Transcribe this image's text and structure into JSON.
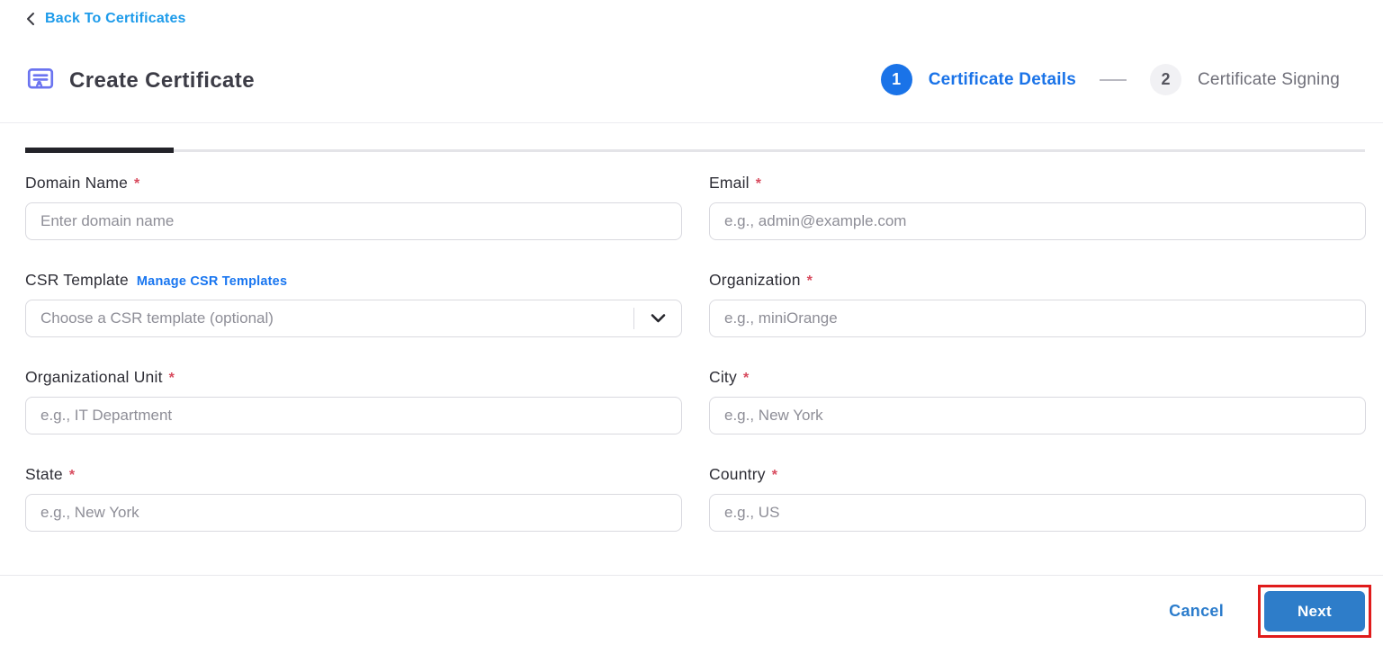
{
  "page": {
    "back_link": "Back To Certificates",
    "title": "Create Certificate"
  },
  "stepper": {
    "steps": [
      {
        "number": "1",
        "label": "Certificate Details",
        "state": "active"
      },
      {
        "number": "2",
        "label": "Certificate Signing",
        "state": "inactive"
      }
    ]
  },
  "form": {
    "required_marker": "*",
    "fields": [
      {
        "key": "domain_name",
        "label": "Domain Name",
        "required": true,
        "placeholder": "Enter domain name"
      },
      {
        "key": "email",
        "label": "Email",
        "required": true,
        "placeholder": "e.g., admin@example.com"
      },
      {
        "key": "csr_template",
        "label": "CSR Template",
        "required": false,
        "link_label": "Manage CSR Templates",
        "placeholder": "Choose a CSR template (optional)"
      },
      {
        "key": "organization",
        "label": "Organization",
        "required": true,
        "placeholder": "e.g., miniOrange"
      },
      {
        "key": "organizational_unit",
        "label": "Organizational Unit",
        "required": true,
        "placeholder": "e.g., IT Department"
      },
      {
        "key": "city",
        "label": "City",
        "required": true,
        "placeholder": "e.g., New York"
      },
      {
        "key": "state",
        "label": "State",
        "required": true,
        "placeholder": "e.g., New York"
      },
      {
        "key": "country",
        "label": "Country",
        "required": true,
        "placeholder": "e.g., US"
      }
    ]
  },
  "footer": {
    "cancel_label": "Cancel",
    "next_label": "Next"
  },
  "colors": {
    "link_blue": "#1d9bea",
    "step_blue": "#1a73e8",
    "inactive_gray": "#6e6e78",
    "button_blue": "#2e7dc9",
    "cancel_blue": "#2b7ccc",
    "annotation_red": "#e01b1b",
    "icon_indigo": "#6b74f0",
    "asterisk_red": "#d84b5e",
    "tab_active": "#232329",
    "border_gray": "#d9d9df",
    "placeholder_gray": "#8e8e97",
    "label_dark": "#2e2e36",
    "title_dark": "#3c3c46"
  }
}
